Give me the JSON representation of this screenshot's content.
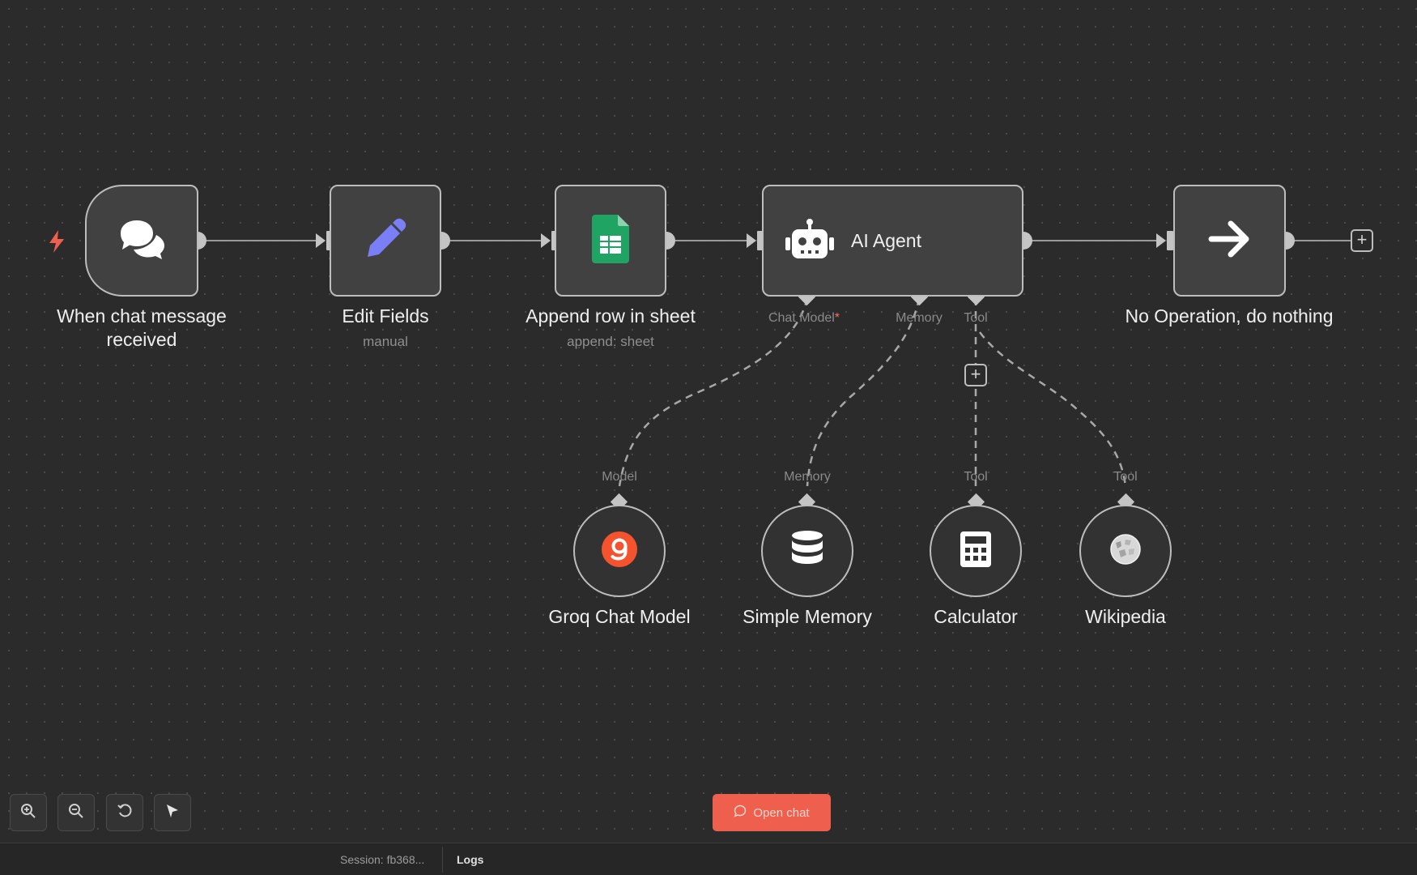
{
  "nodes": {
    "trigger": {
      "label": "When chat message\nreceived"
    },
    "edit_fields": {
      "label": "Edit Fields",
      "subtitle": "manual"
    },
    "append_row": {
      "label": "Append row in sheet",
      "subtitle": "append: sheet"
    },
    "ai_agent": {
      "label": "AI Agent",
      "ports": {
        "chat_model": "Chat Model",
        "required_marker": "*",
        "memory": "Memory",
        "tool": "Tool"
      }
    },
    "no_op": {
      "label": "No Operation, do nothing"
    }
  },
  "sub_nodes": [
    {
      "label": "Groq Chat Model",
      "port": "Model",
      "icon": "groq-icon"
    },
    {
      "label": "Simple Memory",
      "port": "Memory",
      "icon": "database-icon"
    },
    {
      "label": "Calculator",
      "port": "Tool",
      "icon": "calculator-icon"
    },
    {
      "label": "Wikipedia",
      "port": "Tool",
      "icon": "wikipedia-icon"
    }
  ],
  "plus_glyph": "+",
  "toolbar": {
    "buttons": [
      "zoom-in-icon",
      "zoom-out-icon",
      "reset-zoom-icon",
      "pointer-icon"
    ]
  },
  "open_chat": {
    "label": "Open chat"
  },
  "statusbar": {
    "session": "Session: fb368...",
    "logs": "Logs"
  },
  "colors": {
    "background": "#2b2b2b",
    "node_fill": "#414141",
    "node_border": "#bdbdbd",
    "accent_red": "#ee5f4d",
    "sheets_green": "#1fa463",
    "pencil_purple": "#7b7ff5",
    "groq_orange": "#f4532e"
  }
}
